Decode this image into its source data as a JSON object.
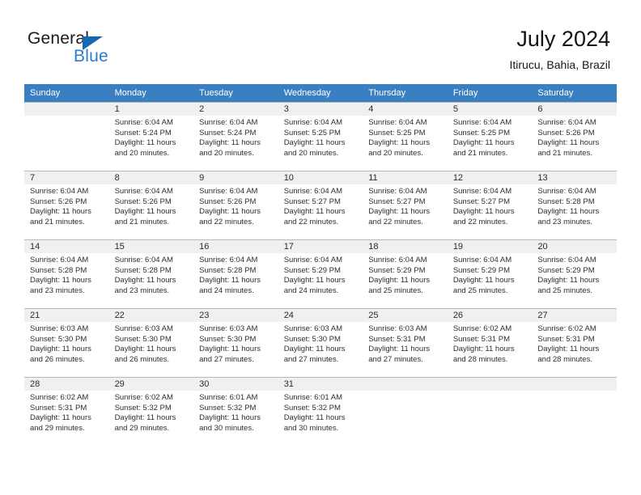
{
  "brand": {
    "name_top": "General",
    "name_bottom": "Blue",
    "accent_color": "#2b7cd3",
    "triangle_color": "#1668b3"
  },
  "header": {
    "title": "July 2024",
    "subtitle": "Itirucu, Bahia, Brazil"
  },
  "calendar": {
    "header_bg": "#3a7fc1",
    "header_text_color": "#ffffff",
    "daynum_band_bg": "#f0f0f0",
    "grid_line_color": "#b9b9b9",
    "weekday_headers": [
      "Sunday",
      "Monday",
      "Tuesday",
      "Wednesday",
      "Thursday",
      "Friday",
      "Saturday"
    ],
    "weeks": [
      [
        {
          "day": "",
          "sunrise": "",
          "sunset": "",
          "daylight_line1": "",
          "daylight_line2": ""
        },
        {
          "day": "1",
          "sunrise": "Sunrise: 6:04 AM",
          "sunset": "Sunset: 5:24 PM",
          "daylight_line1": "Daylight: 11 hours",
          "daylight_line2": "and 20 minutes."
        },
        {
          "day": "2",
          "sunrise": "Sunrise: 6:04 AM",
          "sunset": "Sunset: 5:24 PM",
          "daylight_line1": "Daylight: 11 hours",
          "daylight_line2": "and 20 minutes."
        },
        {
          "day": "3",
          "sunrise": "Sunrise: 6:04 AM",
          "sunset": "Sunset: 5:25 PM",
          "daylight_line1": "Daylight: 11 hours",
          "daylight_line2": "and 20 minutes."
        },
        {
          "day": "4",
          "sunrise": "Sunrise: 6:04 AM",
          "sunset": "Sunset: 5:25 PM",
          "daylight_line1": "Daylight: 11 hours",
          "daylight_line2": "and 20 minutes."
        },
        {
          "day": "5",
          "sunrise": "Sunrise: 6:04 AM",
          "sunset": "Sunset: 5:25 PM",
          "daylight_line1": "Daylight: 11 hours",
          "daylight_line2": "and 21 minutes."
        },
        {
          "day": "6",
          "sunrise": "Sunrise: 6:04 AM",
          "sunset": "Sunset: 5:26 PM",
          "daylight_line1": "Daylight: 11 hours",
          "daylight_line2": "and 21 minutes."
        }
      ],
      [
        {
          "day": "7",
          "sunrise": "Sunrise: 6:04 AM",
          "sunset": "Sunset: 5:26 PM",
          "daylight_line1": "Daylight: 11 hours",
          "daylight_line2": "and 21 minutes."
        },
        {
          "day": "8",
          "sunrise": "Sunrise: 6:04 AM",
          "sunset": "Sunset: 5:26 PM",
          "daylight_line1": "Daylight: 11 hours",
          "daylight_line2": "and 21 minutes."
        },
        {
          "day": "9",
          "sunrise": "Sunrise: 6:04 AM",
          "sunset": "Sunset: 5:26 PM",
          "daylight_line1": "Daylight: 11 hours",
          "daylight_line2": "and 22 minutes."
        },
        {
          "day": "10",
          "sunrise": "Sunrise: 6:04 AM",
          "sunset": "Sunset: 5:27 PM",
          "daylight_line1": "Daylight: 11 hours",
          "daylight_line2": "and 22 minutes."
        },
        {
          "day": "11",
          "sunrise": "Sunrise: 6:04 AM",
          "sunset": "Sunset: 5:27 PM",
          "daylight_line1": "Daylight: 11 hours",
          "daylight_line2": "and 22 minutes."
        },
        {
          "day": "12",
          "sunrise": "Sunrise: 6:04 AM",
          "sunset": "Sunset: 5:27 PM",
          "daylight_line1": "Daylight: 11 hours",
          "daylight_line2": "and 22 minutes."
        },
        {
          "day": "13",
          "sunrise": "Sunrise: 6:04 AM",
          "sunset": "Sunset: 5:28 PM",
          "daylight_line1": "Daylight: 11 hours",
          "daylight_line2": "and 23 minutes."
        }
      ],
      [
        {
          "day": "14",
          "sunrise": "Sunrise: 6:04 AM",
          "sunset": "Sunset: 5:28 PM",
          "daylight_line1": "Daylight: 11 hours",
          "daylight_line2": "and 23 minutes."
        },
        {
          "day": "15",
          "sunrise": "Sunrise: 6:04 AM",
          "sunset": "Sunset: 5:28 PM",
          "daylight_line1": "Daylight: 11 hours",
          "daylight_line2": "and 23 minutes."
        },
        {
          "day": "16",
          "sunrise": "Sunrise: 6:04 AM",
          "sunset": "Sunset: 5:28 PM",
          "daylight_line1": "Daylight: 11 hours",
          "daylight_line2": "and 24 minutes."
        },
        {
          "day": "17",
          "sunrise": "Sunrise: 6:04 AM",
          "sunset": "Sunset: 5:29 PM",
          "daylight_line1": "Daylight: 11 hours",
          "daylight_line2": "and 24 minutes."
        },
        {
          "day": "18",
          "sunrise": "Sunrise: 6:04 AM",
          "sunset": "Sunset: 5:29 PM",
          "daylight_line1": "Daylight: 11 hours",
          "daylight_line2": "and 25 minutes."
        },
        {
          "day": "19",
          "sunrise": "Sunrise: 6:04 AM",
          "sunset": "Sunset: 5:29 PM",
          "daylight_line1": "Daylight: 11 hours",
          "daylight_line2": "and 25 minutes."
        },
        {
          "day": "20",
          "sunrise": "Sunrise: 6:04 AM",
          "sunset": "Sunset: 5:29 PM",
          "daylight_line1": "Daylight: 11 hours",
          "daylight_line2": "and 25 minutes."
        }
      ],
      [
        {
          "day": "21",
          "sunrise": "Sunrise: 6:03 AM",
          "sunset": "Sunset: 5:30 PM",
          "daylight_line1": "Daylight: 11 hours",
          "daylight_line2": "and 26 minutes."
        },
        {
          "day": "22",
          "sunrise": "Sunrise: 6:03 AM",
          "sunset": "Sunset: 5:30 PM",
          "daylight_line1": "Daylight: 11 hours",
          "daylight_line2": "and 26 minutes."
        },
        {
          "day": "23",
          "sunrise": "Sunrise: 6:03 AM",
          "sunset": "Sunset: 5:30 PM",
          "daylight_line1": "Daylight: 11 hours",
          "daylight_line2": "and 27 minutes."
        },
        {
          "day": "24",
          "sunrise": "Sunrise: 6:03 AM",
          "sunset": "Sunset: 5:30 PM",
          "daylight_line1": "Daylight: 11 hours",
          "daylight_line2": "and 27 minutes."
        },
        {
          "day": "25",
          "sunrise": "Sunrise: 6:03 AM",
          "sunset": "Sunset: 5:31 PM",
          "daylight_line1": "Daylight: 11 hours",
          "daylight_line2": "and 27 minutes."
        },
        {
          "day": "26",
          "sunrise": "Sunrise: 6:02 AM",
          "sunset": "Sunset: 5:31 PM",
          "daylight_line1": "Daylight: 11 hours",
          "daylight_line2": "and 28 minutes."
        },
        {
          "day": "27",
          "sunrise": "Sunrise: 6:02 AM",
          "sunset": "Sunset: 5:31 PM",
          "daylight_line1": "Daylight: 11 hours",
          "daylight_line2": "and 28 minutes."
        }
      ],
      [
        {
          "day": "28",
          "sunrise": "Sunrise: 6:02 AM",
          "sunset": "Sunset: 5:31 PM",
          "daylight_line1": "Daylight: 11 hours",
          "daylight_line2": "and 29 minutes."
        },
        {
          "day": "29",
          "sunrise": "Sunrise: 6:02 AM",
          "sunset": "Sunset: 5:32 PM",
          "daylight_line1": "Daylight: 11 hours",
          "daylight_line2": "and 29 minutes."
        },
        {
          "day": "30",
          "sunrise": "Sunrise: 6:01 AM",
          "sunset": "Sunset: 5:32 PM",
          "daylight_line1": "Daylight: 11 hours",
          "daylight_line2": "and 30 minutes."
        },
        {
          "day": "31",
          "sunrise": "Sunrise: 6:01 AM",
          "sunset": "Sunset: 5:32 PM",
          "daylight_line1": "Daylight: 11 hours",
          "daylight_line2": "and 30 minutes."
        },
        {
          "day": "",
          "sunrise": "",
          "sunset": "",
          "daylight_line1": "",
          "daylight_line2": ""
        },
        {
          "day": "",
          "sunrise": "",
          "sunset": "",
          "daylight_line1": "",
          "daylight_line2": ""
        },
        {
          "day": "",
          "sunrise": "",
          "sunset": "",
          "daylight_line1": "",
          "daylight_line2": ""
        }
      ]
    ]
  }
}
